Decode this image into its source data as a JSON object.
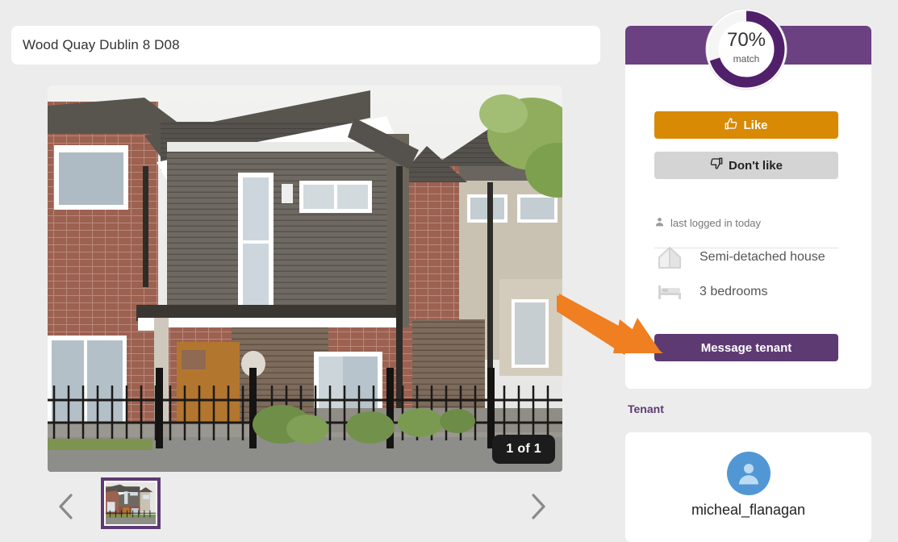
{
  "page": {
    "background_color": "#ececec",
    "brand_purple": "#5e3a73",
    "header_purple": "#6b4182",
    "accent_orange": "#d88a05",
    "annotation_orange": "#ef7f20"
  },
  "listing": {
    "title": "Wood Quay Dublin 8 D08",
    "photo_counter": "1 of 1",
    "photo_alt": "semi-detached brick and grey-clad two storey house with black railings"
  },
  "gallery": {
    "prev_icon": "chevron-left-icon",
    "next_icon": "chevron-right-icon",
    "thumbnails": [
      {
        "label": "1 of 1",
        "selected": true
      }
    ]
  },
  "match": {
    "percent": "70%",
    "label": "match",
    "value": 70,
    "ring_color": "#51206b",
    "ring_track_color": "#f4f4f4"
  },
  "actions": {
    "like": {
      "label": "Like",
      "icon": "thumbs-up-icon",
      "color": "#d88a05"
    },
    "dislike": {
      "label": "Don't like",
      "icon": "thumbs-down-icon",
      "color": "#d4d4d4"
    },
    "message": {
      "label": "Message tenant",
      "color": "#5e3a73"
    }
  },
  "status": {
    "last_login": "last logged in today",
    "icon": "person-icon"
  },
  "features": [
    {
      "icon": "house-icon",
      "text": "Semi-detached house"
    },
    {
      "icon": "bed-icon",
      "text": "3 bedrooms"
    }
  ],
  "tenant": {
    "section_label": "Tenant",
    "avatar_icon": "person-avatar-icon",
    "username": "micheal_flanagan"
  }
}
